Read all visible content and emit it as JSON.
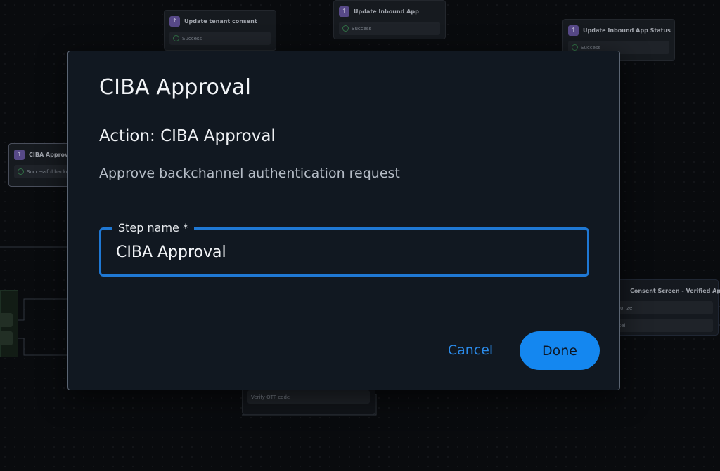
{
  "background_nodes": {
    "update_tenant_consent": {
      "title": "Update tenant consent",
      "row": "Success"
    },
    "update_inbound_app": {
      "title": "Update Inbound App",
      "row": "Success"
    },
    "update_inbound_app_status": {
      "title": "Update Inbound App Status",
      "row": "Success"
    },
    "ciba_approval": {
      "title": "CIBA Approval",
      "row": "Successful backcha"
    },
    "consent_screen": {
      "title": "Consent Screen - Verified App",
      "rows": [
        "thorize",
        "ncel"
      ]
    },
    "verify_otp": {
      "row": "Verify OTP code"
    }
  },
  "dialog": {
    "title": "CIBA Approval",
    "action_title": "Action: CIBA Approval",
    "description": "Approve backchannel authentication request",
    "step_name_label": "Step name *",
    "step_name_value": "CIBA Approval",
    "cancel_label": "Cancel",
    "done_label": "Done"
  },
  "colors": {
    "accent": "#1487f0",
    "node_icon": "#6b5aa6",
    "modal_bg": "#111821",
    "canvas_bg": "#0b0e12"
  },
  "icons": {
    "node_icon": "workflow-step-icon",
    "row_status": "check-circle-icon"
  }
}
